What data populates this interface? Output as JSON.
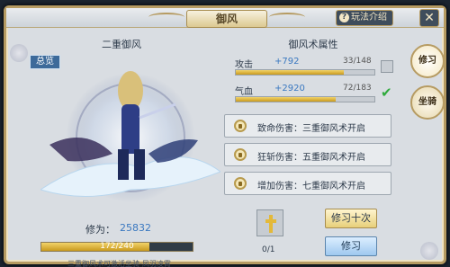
{
  "window": {
    "title": "御风",
    "help_label": "玩法介绍",
    "help_icon": "?",
    "close_label": "✕"
  },
  "left": {
    "name": "二重御风",
    "overview_label": "总览",
    "xiuwei_label": "修为：",
    "xiuwei_value": "25832",
    "exp_text": "172/240",
    "exp_progress": 0.717,
    "hint": "三重御风术可激活坐骑-凤羽凌霄"
  },
  "right": {
    "title": "御风术属性",
    "attributes": [
      {
        "name": "攻击",
        "bonus": "+792",
        "level": "33/148",
        "progress": 0.78,
        "checked": false
      },
      {
        "name": "气血",
        "bonus": "+2920",
        "level": "72/183",
        "progress": 0.72,
        "checked": true
      }
    ],
    "bonuses": [
      {
        "text": "致命伤害：三重御风术开启"
      },
      {
        "text": "狂斩伤害：五重御风术开启"
      },
      {
        "text": "增加伤害：七重御风术开启"
      }
    ],
    "item_count": "0/1",
    "btn_ten_label": "修习十次",
    "btn_one_label": "修习"
  },
  "side_tabs": [
    {
      "label": "修习",
      "active": true
    },
    {
      "label": "坐骑",
      "active": false
    }
  ],
  "colors": {
    "gold": "#b69b62",
    "bar_fill": "#e3b93a",
    "accent_blue": "#3a78c0"
  }
}
